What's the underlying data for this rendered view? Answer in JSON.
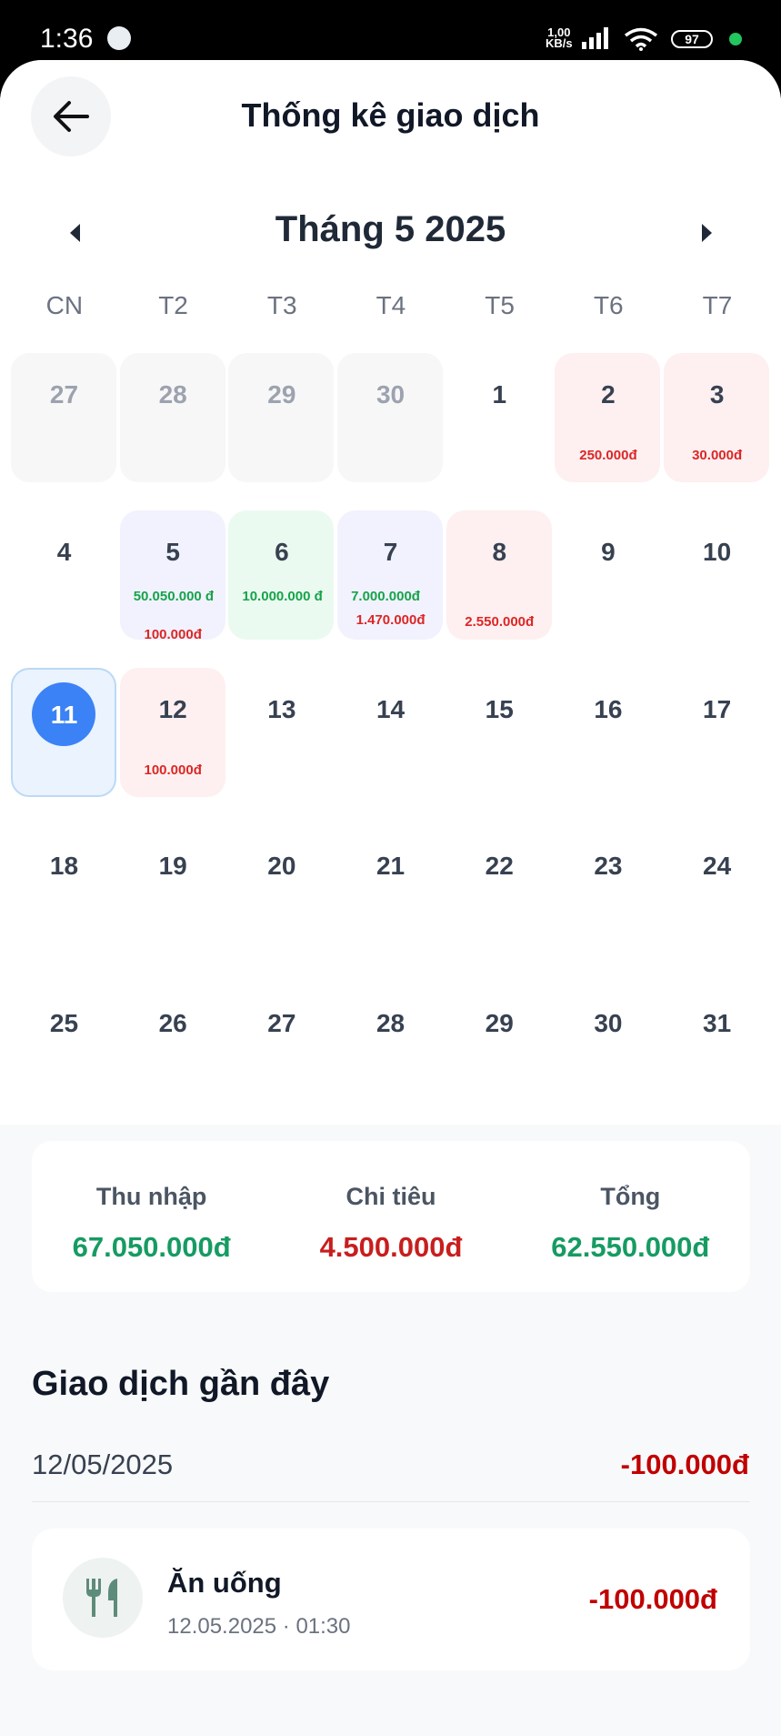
{
  "status_bar": {
    "time": "1:36",
    "net_speed_value": "1,00",
    "net_speed_unit": "KB/s",
    "battery": "97",
    "icons": [
      "app-notification-icon",
      "signal-icon",
      "wifi-icon",
      "battery-icon",
      "privacy-dot"
    ]
  },
  "header": {
    "title": "Thống kê giao dịch",
    "back_icon": "arrow-left-icon"
  },
  "calendar": {
    "month_title": "Tháng 5 2025",
    "prev_icon": "caret-left-icon",
    "next_icon": "caret-right-icon",
    "weekdays": [
      "CN",
      "T2",
      "T3",
      "T4",
      "T5",
      "T6",
      "T7"
    ],
    "days": [
      {
        "day": "27",
        "state": "other",
        "income": "",
        "expense": ""
      },
      {
        "day": "28",
        "state": "other",
        "income": "",
        "expense": ""
      },
      {
        "day": "29",
        "state": "other",
        "income": "",
        "expense": ""
      },
      {
        "day": "30",
        "state": "other",
        "income": "",
        "expense": ""
      },
      {
        "day": "1",
        "state": "plain",
        "income": "",
        "expense": ""
      },
      {
        "day": "2",
        "state": "expense",
        "income": "",
        "expense": "250.000đ"
      },
      {
        "day": "3",
        "state": "expense",
        "income": "",
        "expense": "30.000đ"
      },
      {
        "day": "4",
        "state": "plain",
        "income": "",
        "expense": ""
      },
      {
        "day": "5",
        "state": "mixed",
        "income": "50.050.000 đ",
        "expense": "100.000đ"
      },
      {
        "day": "6",
        "state": "income",
        "income": "10.000.000 đ",
        "expense": ""
      },
      {
        "day": "7",
        "state": "mixed",
        "income": "7.000.000đ",
        "expense": "1.470.000đ"
      },
      {
        "day": "8",
        "state": "expense",
        "income": "",
        "expense": "2.550.000đ"
      },
      {
        "day": "9",
        "state": "plain",
        "income": "",
        "expense": ""
      },
      {
        "day": "10",
        "state": "plain",
        "income": "",
        "expense": ""
      },
      {
        "day": "11",
        "state": "today",
        "income": "",
        "expense": ""
      },
      {
        "day": "12",
        "state": "expense",
        "income": "",
        "expense": "100.000đ"
      },
      {
        "day": "13",
        "state": "plain",
        "income": "",
        "expense": ""
      },
      {
        "day": "14",
        "state": "plain",
        "income": "",
        "expense": ""
      },
      {
        "day": "15",
        "state": "plain",
        "income": "",
        "expense": ""
      },
      {
        "day": "16",
        "state": "plain",
        "income": "",
        "expense": ""
      },
      {
        "day": "17",
        "state": "plain",
        "income": "",
        "expense": ""
      },
      {
        "day": "18",
        "state": "plain",
        "income": "",
        "expense": ""
      },
      {
        "day": "19",
        "state": "plain",
        "income": "",
        "expense": ""
      },
      {
        "day": "20",
        "state": "plain",
        "income": "",
        "expense": ""
      },
      {
        "day": "21",
        "state": "plain",
        "income": "",
        "expense": ""
      },
      {
        "day": "22",
        "state": "plain",
        "income": "",
        "expense": ""
      },
      {
        "day": "23",
        "state": "plain",
        "income": "",
        "expense": ""
      },
      {
        "day": "24",
        "state": "plain",
        "income": "",
        "expense": ""
      },
      {
        "day": "25",
        "state": "plain",
        "income": "",
        "expense": ""
      },
      {
        "day": "26",
        "state": "plain",
        "income": "",
        "expense": ""
      },
      {
        "day": "27",
        "state": "plain",
        "income": "",
        "expense": ""
      },
      {
        "day": "28",
        "state": "plain",
        "income": "",
        "expense": ""
      },
      {
        "day": "29",
        "state": "plain",
        "income": "",
        "expense": ""
      },
      {
        "day": "30",
        "state": "plain",
        "income": "",
        "expense": ""
      },
      {
        "day": "31",
        "state": "plain",
        "income": "",
        "expense": ""
      }
    ]
  },
  "summary": {
    "income_label": "Thu nhập",
    "income_value": "67.050.000đ",
    "expense_label": "Chi tiêu",
    "expense_value": "4.500.000đ",
    "total_label": "Tổng",
    "total_value": "62.550.000đ"
  },
  "recent": {
    "title": "Giao dịch gần đây",
    "groups": [
      {
        "date": "12/05/2025",
        "total": "-100.000đ",
        "items": [
          {
            "name": "Ăn uống",
            "time": "12.05.2025 · 01:30",
            "amount": "-100.000đ",
            "icon": "fork-knife-icon"
          }
        ]
      }
    ]
  },
  "colors": {
    "income": "#16a34a",
    "expense": "#dc2626",
    "total_negative": "#c00000",
    "today": "#3b82f6"
  }
}
